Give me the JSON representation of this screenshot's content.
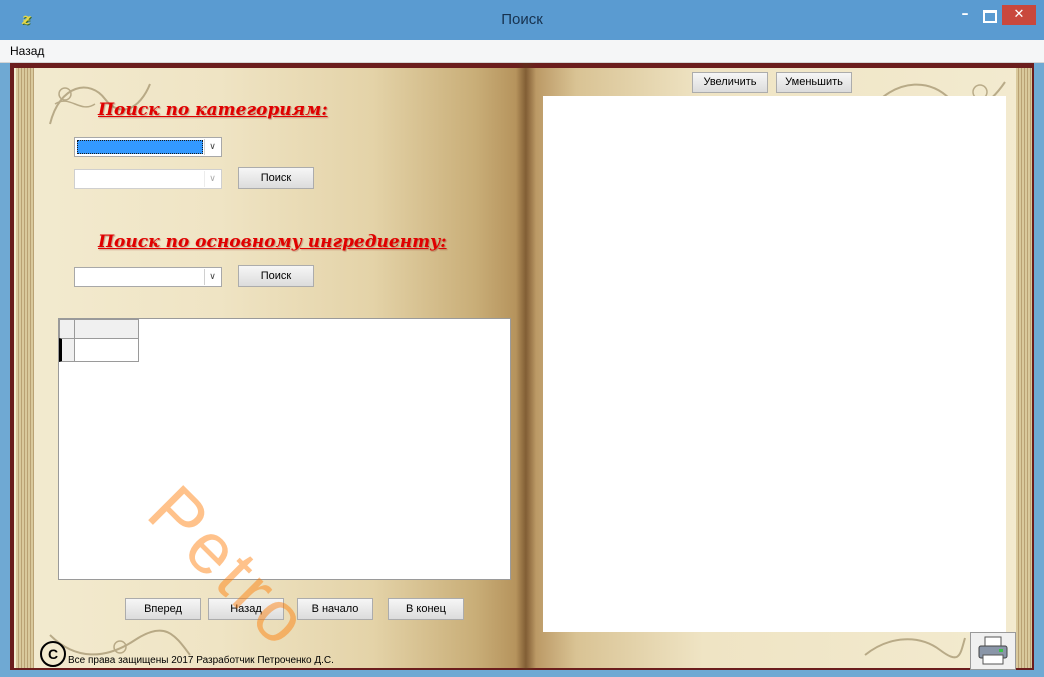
{
  "window": {
    "title": "Поиск",
    "minimize_glyph": "–",
    "close_glyph": "✕",
    "app_icon_glyph": "ƶ"
  },
  "menu": {
    "items": [
      "Назад"
    ]
  },
  "left_page": {
    "category_heading": "Поиск по категориям:",
    "ingredient_heading": "Поиск по основному ингредиенту:",
    "category_combo_1": {
      "value": "",
      "state": "selected"
    },
    "category_combo_2": {
      "value": "",
      "state": "disabled"
    },
    "ingredient_combo": {
      "value": ""
    },
    "search_button_1": "Поиск",
    "search_button_2": "Поиск",
    "nav_buttons": [
      "Вперед",
      "Назад",
      "В начало",
      "В конец"
    ],
    "copyright_symbol": "C",
    "copyright_text": "Все права защищены 2017 Разработчик Петроченко Д.С."
  },
  "right_page": {
    "zoom_in_button": "Увеличить",
    "zoom_out_button": "Уменьшить"
  },
  "watermark": "Petro",
  "icons": {
    "dropdown": "chevron-down-icon",
    "print": "printer-icon",
    "copyright": "copyright-icon"
  },
  "colors": {
    "titlebar": "#5a9bd1",
    "heading_red": "#e00000",
    "selection_blue": "#3399ff",
    "book_cover": "#6b1d1d",
    "close_button": "#c9483d"
  }
}
